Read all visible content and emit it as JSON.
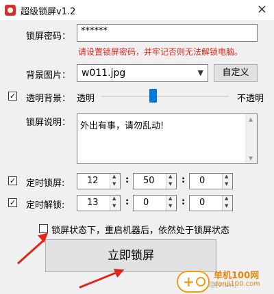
{
  "window": {
    "title": "超级锁屏v1.2",
    "close_icon": "×"
  },
  "password": {
    "label": "锁屏密码：",
    "value": "******",
    "hint": "请设置锁屏密码，并牢记否则无法解锁电脑。"
  },
  "background": {
    "label": "背景图片：",
    "selected": "w011.jpg",
    "custom_button": "自定义"
  },
  "transparency": {
    "checked": true,
    "label": "透明背景：",
    "left_label": "透明",
    "right_label": "不透明",
    "level_percent": 40
  },
  "description": {
    "label": "锁屏说明：",
    "text": "外出有事，请勿乱动!"
  },
  "timed_lock": {
    "checked": true,
    "label": "定时锁屏:",
    "hour": "12",
    "minute": "50",
    "second": "0",
    "sep": ":"
  },
  "timed_unlock": {
    "checked": true,
    "label": "定时解锁:",
    "hour": "13",
    "minute": "0",
    "second": "0",
    "sep": ":"
  },
  "persist": {
    "checked": false,
    "label": "锁屏状态下，重启机器后，依然处于锁屏状态"
  },
  "lock_button": "立即锁屏",
  "watermark": {
    "site": "单机100网",
    "url": "danji100.com",
    "ghost": "隐(Visin)"
  },
  "colors": {
    "accent": "#0078d7",
    "hint": "#e0241b",
    "arrow": "#e0241b",
    "watermark": "#f39c12"
  },
  "icons": {
    "check": "✓",
    "chevron": "chevron-down-icon"
  }
}
